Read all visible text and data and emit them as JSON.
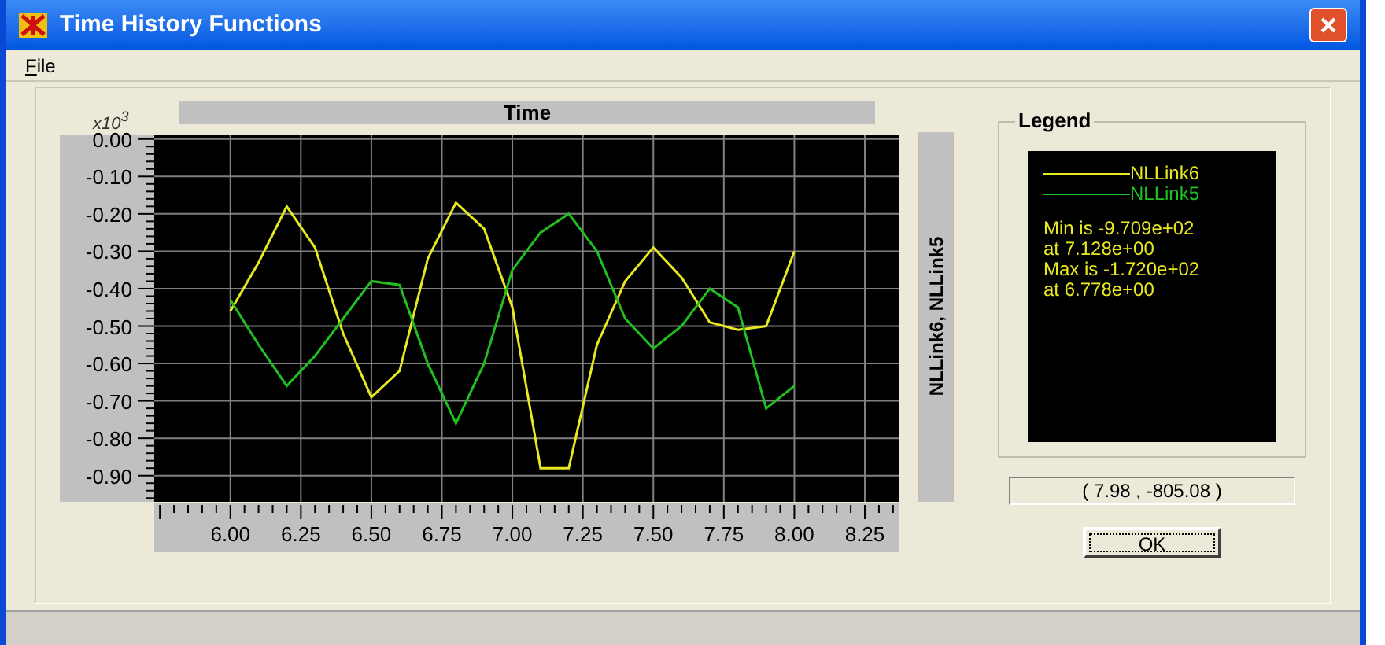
{
  "window": {
    "title": "Time History Functions"
  },
  "menu": [
    {
      "label": "File"
    }
  ],
  "chart": {
    "axis_multiplier": {
      "base": "x10",
      "exponent": "3"
    },
    "chart_data": {
      "type": "line",
      "title": "Time",
      "ylabel": "NLLink6, NLLink5",
      "x": [
        6.0,
        6.1,
        6.2,
        6.3,
        6.4,
        6.5,
        6.6,
        6.7,
        6.8,
        6.9,
        7.0,
        7.1,
        7.2,
        7.3,
        7.4,
        7.5,
        7.6,
        7.7,
        7.8,
        7.9,
        8.0
      ],
      "series": [
        {
          "name": "NLLink6",
          "color": "#e8e820",
          "values": [
            -0.46,
            -0.33,
            -0.18,
            -0.29,
            -0.52,
            -0.69,
            -0.62,
            -0.32,
            -0.17,
            -0.24,
            -0.45,
            -0.88,
            -0.88,
            -0.55,
            -0.38,
            -0.29,
            -0.37,
            -0.49,
            -0.51,
            -0.5,
            -0.3
          ]
        },
        {
          "name": "NLLink5",
          "color": "#20c020",
          "values": [
            -0.43,
            -0.55,
            -0.66,
            -0.58,
            -0.48,
            -0.38,
            -0.39,
            -0.6,
            -0.76,
            -0.6,
            -0.35,
            -0.25,
            -0.2,
            -0.3,
            -0.48,
            -0.56,
            -0.5,
            -0.4,
            -0.45,
            -0.72,
            -0.66
          ]
        }
      ],
      "grid": true,
      "xlim": [
        5.73,
        8.37
      ],
      "ylim": [
        -0.97,
        0.01
      ],
      "xticks": [
        {
          "value": 6,
          "label": "6.00"
        },
        {
          "value": 6.25,
          "label": "6.25"
        },
        {
          "value": 6.5,
          "label": "6.50"
        },
        {
          "value": 6.75,
          "label": "6.75"
        },
        {
          "value": 7,
          "label": "7.00"
        },
        {
          "value": 7.25,
          "label": "7.25"
        },
        {
          "value": 7.5,
          "label": "7.50"
        },
        {
          "value": 7.75,
          "label": "7.75"
        },
        {
          "value": 8,
          "label": "8.00"
        },
        {
          "value": 8.25,
          "label": "8.25"
        }
      ],
      "yticks": [
        {
          "value": 0,
          "label": "0.00"
        },
        {
          "value": -0.1,
          "label": "-0.10"
        },
        {
          "value": -0.2,
          "label": "-0.20"
        },
        {
          "value": -0.3,
          "label": "-0.30"
        },
        {
          "value": -0.4,
          "label": "-0.40"
        },
        {
          "value": -0.5,
          "label": "-0.50"
        },
        {
          "value": -0.6,
          "label": "-0.60"
        },
        {
          "value": -0.7,
          "label": "-0.70"
        },
        {
          "value": -0.8,
          "label": "-0.80"
        },
        {
          "value": -0.9,
          "label": "-0.90"
        }
      ]
    }
  },
  "legend": {
    "title": "Legend",
    "stats": [
      "Min is -9.709e+02",
      "at 7.128e+00",
      "Max is -1.720e+02",
      "at 6.778e+00"
    ]
  },
  "readout": "( 7.98 , -805.08 )",
  "buttons": [
    {
      "label": "OK"
    }
  ]
}
